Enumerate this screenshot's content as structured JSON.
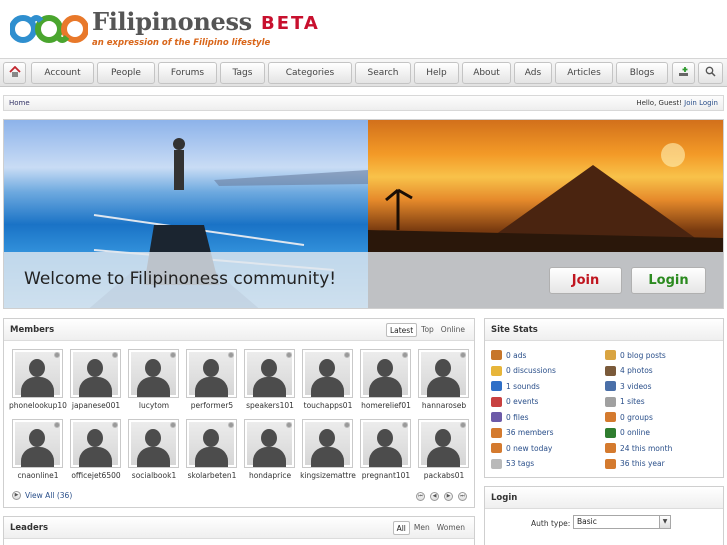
{
  "brand": {
    "title": "Filipinoness",
    "beta": "BETA",
    "tagline": "an expression of the Filipino lifestyle"
  },
  "nav": {
    "home_icon": "home-icon",
    "items": [
      "Account",
      "People",
      "Forums",
      "Tags",
      "Categories",
      "Search",
      "Help",
      "About",
      "Ads",
      "Articles",
      "Blogs"
    ],
    "add_icon": "add-user-icon",
    "search_icon": "search-icon"
  },
  "breadcrumb": {
    "home": "Home",
    "greeting": "Hello, Guest!",
    "join": "Join",
    "login": "Login"
  },
  "hero": {
    "welcome": "Welcome to Filipinoness community!",
    "join_label": "Join",
    "login_label": "Login"
  },
  "members": {
    "title": "Members",
    "tabs": [
      "Latest",
      "Top",
      "Online"
    ],
    "active_tab": "Latest",
    "names": [
      "phonelookup10",
      "japanese001",
      "lucytom",
      "performer5",
      "speakers101",
      "touchapps01",
      "homerelief01",
      "hannaroseb",
      "cnaonline1",
      "officejet6500",
      "socialbook1",
      "skolarbeten1",
      "hondaprice",
      "kingsizemattre",
      "pregnant101",
      "packabs01"
    ],
    "view_all": "View All (36)"
  },
  "leaders": {
    "title": "Leaders",
    "tabs": [
      "All",
      "Men",
      "Women"
    ],
    "active_tab": "All"
  },
  "site_stats": {
    "title": "Site Stats",
    "left": [
      {
        "text": "0 ads",
        "icon": "ads-icon",
        "color": "#c7762a"
      },
      {
        "text": "0 discussions",
        "icon": "discussion-icon",
        "color": "#e7b53a"
      },
      {
        "text": "1 sounds",
        "icon": "music-icon",
        "color": "#2f6fc7"
      },
      {
        "text": "0 events",
        "icon": "calendar-icon",
        "color": "#c84040"
      },
      {
        "text": "0 files",
        "icon": "disk-icon",
        "color": "#6c5aa8"
      },
      {
        "text": "36 members",
        "icon": "members-icon",
        "color": "#d47a2e"
      },
      {
        "text": "0 new today",
        "icon": "new-members-icon",
        "color": "#d47a2e"
      },
      {
        "text": "53 tags",
        "icon": "tag-icon",
        "color": "#b9b9b9"
      }
    ],
    "right": [
      {
        "text": "0 blog posts",
        "icon": "blog-icon",
        "color": "#d9a441"
      },
      {
        "text": "4 photos",
        "icon": "photo-icon",
        "color": "#7a5a3a"
      },
      {
        "text": "3 videos",
        "icon": "video-icon",
        "color": "#4a6fa8"
      },
      {
        "text": "1 sites",
        "icon": "sites-icon",
        "color": "#a0a0a0"
      },
      {
        "text": "0 groups",
        "icon": "groups-icon",
        "color": "#d47a2e"
      },
      {
        "text": "0 online",
        "icon": "online-icon",
        "color": "#2f7d2f"
      },
      {
        "text": "24 this month",
        "icon": "month-icon",
        "color": "#d47a2e"
      },
      {
        "text": "36 this year",
        "icon": "year-icon",
        "color": "#d47a2e"
      }
    ]
  },
  "login_panel": {
    "title": "Login",
    "auth_label": "Auth type:",
    "auth_value": "Basic"
  }
}
